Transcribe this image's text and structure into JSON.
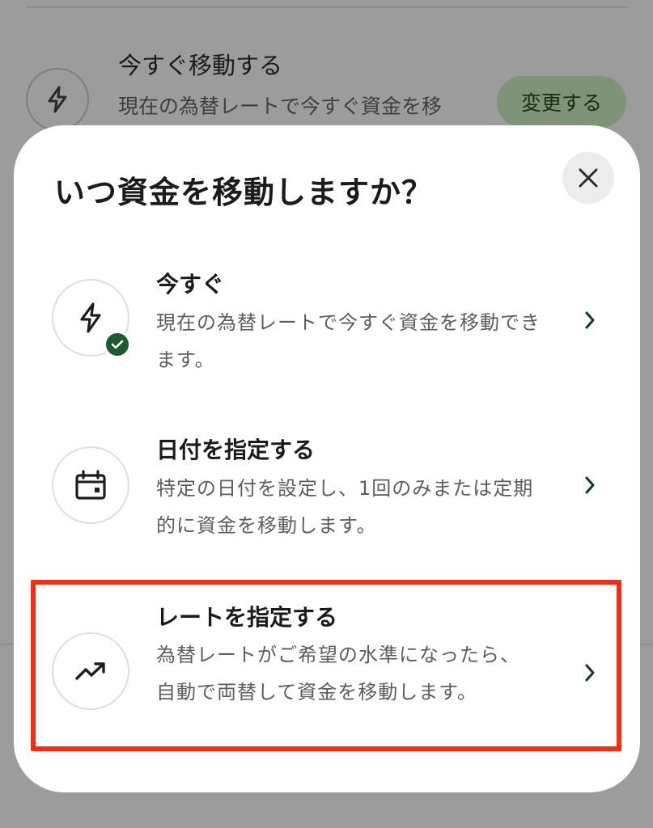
{
  "background": {
    "option_title": "今すぐ移動する",
    "option_desc": "現在の為替レートで今すぐ資金を移",
    "change_button_label": "変更する",
    "icon": "lightning-icon"
  },
  "sheet": {
    "title": "いつ資金を移動しますか？",
    "close_icon": "close-icon",
    "options": [
      {
        "title": "今すぐ",
        "desc": "現在の為替レートで今すぐ資金を移動できます。",
        "icon": "lightning-icon",
        "selected": true
      },
      {
        "title": "日付を指定する",
        "desc": "特定の日付を設定し、1回のみまたは定期的に資金を移動します。",
        "icon": "calendar-icon",
        "selected": false
      },
      {
        "title": "レートを指定する",
        "desc": "為替レートがご希望の水準になったら、自動で両替して資金を移動します。",
        "icon": "trend-up-icon",
        "selected": false,
        "highlighted": true
      }
    ]
  },
  "colors": {
    "accent_green": "#1d5a32",
    "highlight_red": "#ff2a12",
    "chevron_green": "#163a1e"
  }
}
